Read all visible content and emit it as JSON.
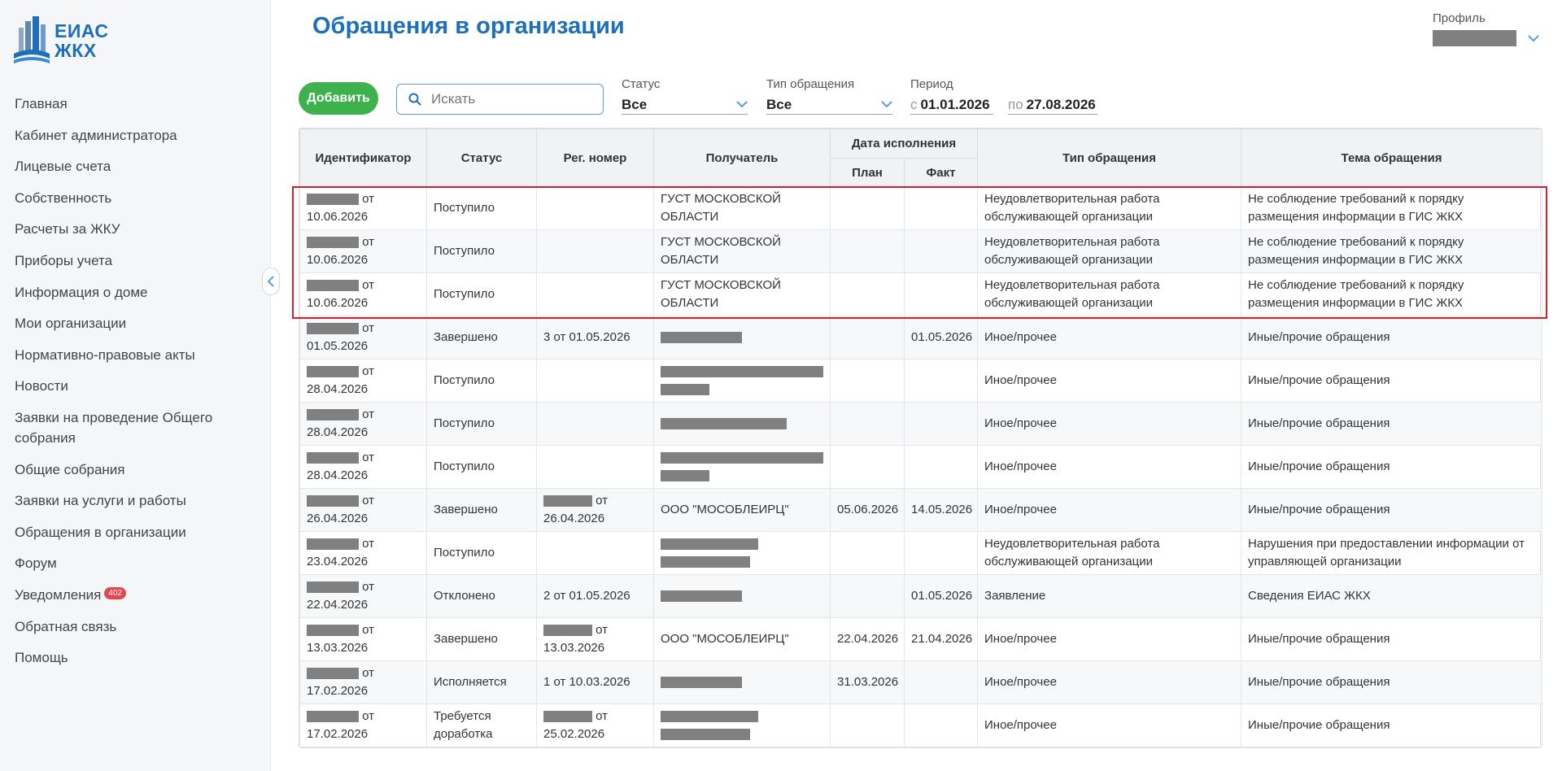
{
  "brand": {
    "line1": "ЕИАС",
    "line2": "ЖКХ",
    "logo_icon": "building-logo-icon"
  },
  "sidebar": {
    "items": [
      {
        "label": "Главная"
      },
      {
        "label": "Кабинет администратора"
      },
      {
        "label": "Лицевые счета"
      },
      {
        "label": "Собственность"
      },
      {
        "label": "Расчеты за ЖКУ"
      },
      {
        "label": "Приборы учета"
      },
      {
        "label": "Информация о доме"
      },
      {
        "label": "Мои организации"
      },
      {
        "label": "Нормативно-правовые акты"
      },
      {
        "label": "Новости"
      },
      {
        "label": "Заявки на проведение Общего собрания"
      },
      {
        "label": "Общие собрания"
      },
      {
        "label": "Заявки на услуги и работы"
      },
      {
        "label": "Обращения в организации"
      },
      {
        "label": "Форум"
      },
      {
        "label": "Уведомления",
        "badge": "402"
      },
      {
        "label": "Обратная связь"
      },
      {
        "label": "Помощь"
      }
    ]
  },
  "header": {
    "title": "Обращения в организации",
    "profile_label": "Профиль"
  },
  "toolbar": {
    "add_label": "Добавить",
    "search_placeholder": "Искать",
    "status_label": "Статус",
    "status_value": "Все",
    "type_label": "Тип обращения",
    "type_value": "Все",
    "period_label": "Период",
    "period_from_prefix": "с",
    "period_from": "01.01.2026",
    "period_to_prefix": "по",
    "period_to": "27.08.2026"
  },
  "table": {
    "headers": {
      "id": "Идентификатор",
      "status": "Статус",
      "reg": "Рег. номер",
      "recipient": "Получатель",
      "date_group": "Дата исполнения",
      "plan": "План",
      "fact": "Факт",
      "type": "Тип обращения",
      "topic": "Тема обращения"
    },
    "rows": [
      {
        "id_suffix": "от",
        "id_date": "10.06.2026",
        "status": "Поступило",
        "reg_prefix": "",
        "reg_text": "",
        "recipient_text": "ГУСТ МОСКОВСКОЙ ОБЛАСТИ",
        "plan": "",
        "fact": "",
        "type": "Неудовлетворительная работа обслуживающей организации",
        "topic": "Не соблюдение требований к порядку размещения информации в ГИС ЖКХ"
      },
      {
        "id_suffix": "от",
        "id_date": "10.06.2026",
        "status": "Поступило",
        "reg_prefix": "",
        "reg_text": "",
        "recipient_text": "ГУСТ МОСКОВСКОЙ ОБЛАСТИ",
        "plan": "",
        "fact": "",
        "type": "Неудовлетворительная работа обслуживающей организации",
        "topic": "Не соблюдение требований к порядку размещения информации в ГИС ЖКХ"
      },
      {
        "id_suffix": "от",
        "id_date": "10.06.2026",
        "status": "Поступило",
        "reg_prefix": "",
        "reg_text": "",
        "recipient_text": "ГУСТ МОСКОВСКОЙ ОБЛАСТИ",
        "plan": "",
        "fact": "",
        "type": "Неудовлетворительная работа обслуживающей организации",
        "topic": "Не соблюдение требований к порядку размещения информации в ГИС ЖКХ"
      },
      {
        "id_suffix": "от",
        "id_date": "01.05.2026",
        "status": "Завершено",
        "reg_prefix": "",
        "reg_text": "3 от 01.05.2026",
        "recipient_text": "",
        "plan": "",
        "fact": "01.05.2026",
        "type": "Иное/прочее",
        "topic": "Иные/прочие обращения"
      },
      {
        "id_suffix": "от",
        "id_date": "28.04.2026",
        "status": "Поступило",
        "reg_prefix": "",
        "reg_text": "",
        "recipient_text": "",
        "plan": "",
        "fact": "",
        "type": "Иное/прочее",
        "topic": "Иные/прочие обращения"
      },
      {
        "id_suffix": "от",
        "id_date": "28.04.2026",
        "status": "Поступило",
        "reg_prefix": "",
        "reg_text": "",
        "recipient_text": "",
        "plan": "",
        "fact": "",
        "type": "Иное/прочее",
        "topic": "Иные/прочие обращения"
      },
      {
        "id_suffix": "от",
        "id_date": "28.04.2026",
        "status": "Поступило",
        "reg_prefix": "",
        "reg_text": "",
        "recipient_text": "",
        "plan": "",
        "fact": "",
        "type": "Иное/прочее",
        "topic": "Иные/прочие обращения"
      },
      {
        "id_suffix": "от",
        "id_date": "26.04.2026",
        "status": "Завершено",
        "reg_prefix": "от",
        "reg_text": "26.04.2026",
        "recipient_text": "ООО \"МОСОБЛЕИРЦ\"",
        "plan": "05.06.2026",
        "fact": "14.05.2026",
        "type": "Иное/прочее",
        "topic": "Иные/прочие обращения"
      },
      {
        "id_suffix": "от",
        "id_date": "23.04.2026",
        "status": "Поступило",
        "reg_prefix": "",
        "reg_text": "",
        "recipient_text": "",
        "plan": "",
        "fact": "",
        "type": "Неудовлетворительная работа обслуживающей организации",
        "topic": "Нарушения при предоставлении информации от управляющей организации"
      },
      {
        "id_suffix": "от",
        "id_date": "22.04.2026",
        "status": "Отклонено",
        "reg_prefix": "",
        "reg_text": "2 от 01.05.2026",
        "recipient_text": "",
        "plan": "",
        "fact": "01.05.2026",
        "type": "Заявление",
        "topic": "Сведения ЕИАС ЖКХ"
      },
      {
        "id_suffix": "от",
        "id_date": "13.03.2026",
        "status": "Завершено",
        "reg_prefix": "от",
        "reg_text": "13.03.2026",
        "recipient_text": "ООО \"МОСОБЛЕИРЦ\"",
        "plan": "22.04.2026",
        "fact": "21.04.2026",
        "type": "Иное/прочее",
        "topic": "Иные/прочие обращения"
      },
      {
        "id_suffix": "от",
        "id_date": "17.02.2026",
        "status": "Исполняется",
        "reg_prefix": "",
        "reg_text": "1 от 10.03.2026",
        "recipient_text": "",
        "plan": "31.03.2026",
        "fact": "",
        "type": "Иное/прочее",
        "topic": "Иные/прочие обращения"
      },
      {
        "id_suffix": "от",
        "id_date": "17.02.2026",
        "status": "Требуется доработка",
        "reg_prefix": "от",
        "reg_text": "25.02.2026",
        "recipient_text": "",
        "plan": "",
        "fact": "",
        "type": "Иное/прочее",
        "topic": "Иные/прочие обращения"
      }
    ]
  },
  "colors": {
    "accent": "#1e6fb8",
    "add_button": "#3db14c",
    "badge": "#e2474f",
    "highlight": "#d01f2e",
    "redaction": "#808080"
  }
}
